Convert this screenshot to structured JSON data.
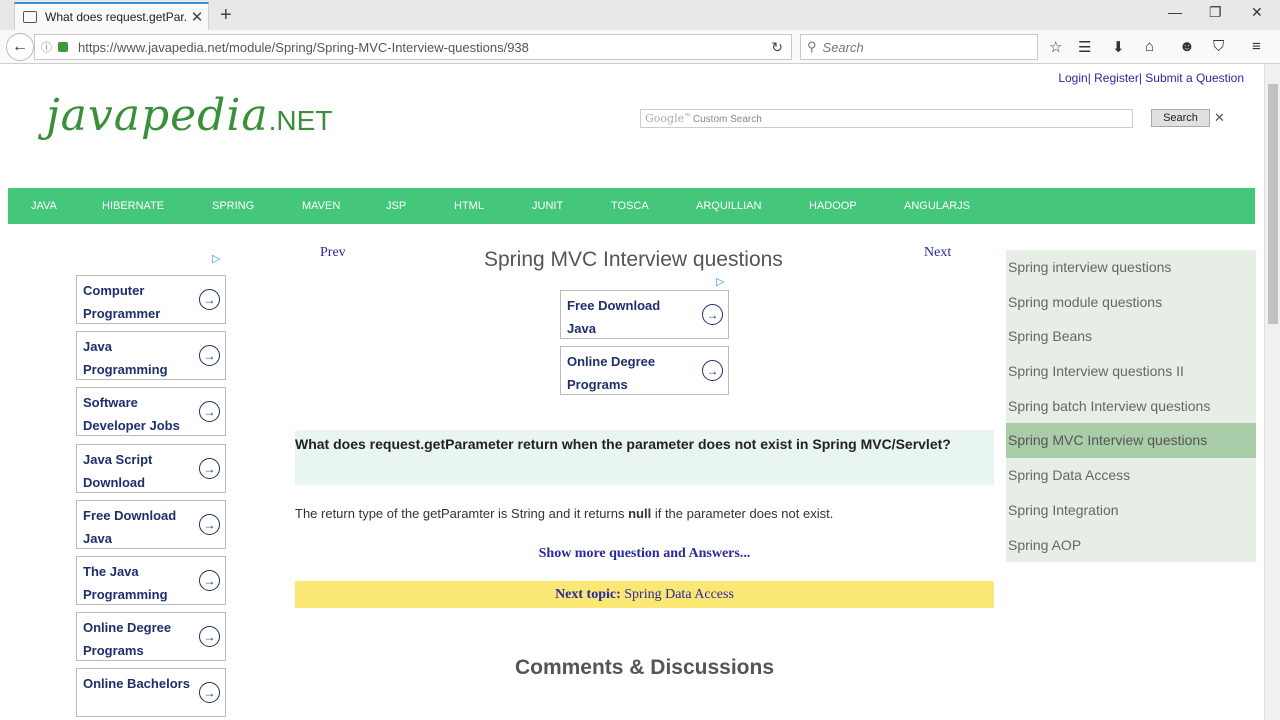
{
  "browser": {
    "tab_title": "What does request.getPar...",
    "url": "https://www.javapedia.net/module/Spring/Spring-MVC-Interview-questions/938",
    "search_placeholder": "Search"
  },
  "header": {
    "login": "Login",
    "register": "Register",
    "submit": "Submit a Question",
    "logo_main": "javapedia",
    "logo_suffix": ".NET",
    "search_placeholder": "Custom Search",
    "search_brand": "Google",
    "search_button": "Search"
  },
  "menu": [
    "JAVA",
    "HIBERNATE",
    "SPRING",
    "MAVEN",
    "JSP",
    "HTML",
    "JUNIT",
    "TOSCA",
    "ARQUILLIAN",
    "HADOOP",
    "ANGULARJS"
  ],
  "left_ads": [
    "Computer Programmer",
    "Java Programming",
    "Software Developer Jobs",
    "Java Script Download",
    "Free Download Java",
    "The Java Programming",
    "Online Degree Programs",
    "Online Bachelors"
  ],
  "center_ads": [
    "Free Download Java",
    "Online Degree Programs"
  ],
  "article": {
    "prev": "Prev",
    "next": "Next",
    "title": "Spring MVC Interview questions",
    "question": "What does request.getParameter return when the parameter does not exist in Spring MVC/Servlet?",
    "answer_pre": "The return type of the getParamter is String and it returns ",
    "answer_bold": "null",
    "answer_post": " if the parameter does not exist.",
    "show_more": "Show more question and Answers...",
    "next_topic_label": "Next topic:",
    "next_topic_value": "Spring Data Access",
    "comments": "Comments & Discussions"
  },
  "sidebar": [
    "Spring interview questions",
    "Spring module questions",
    "Spring Beans",
    "Spring Interview questions II",
    "Spring batch Interview questions",
    "Spring MVC Interview questions",
    "Spring Data Access",
    "Spring Integration",
    "Spring AOP"
  ],
  "sidebar_active_index": 5,
  "colors": {
    "menu": "#44c77a",
    "highlight": "#fbe774",
    "link": "#2a2aa0"
  }
}
